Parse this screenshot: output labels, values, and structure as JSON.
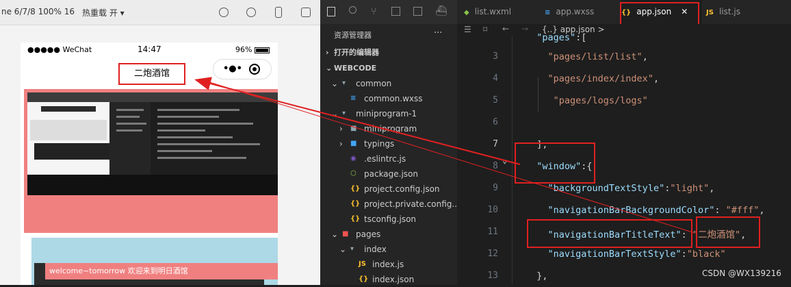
{
  "simulator": {
    "toolbar_device": "ne 6/7/8 100% 16",
    "toolbar_hotreload": "热重载 开",
    "status_carrier": "●●●●● WeChat",
    "status_time": "14:47",
    "status_battery": "96%",
    "nav_title": "二炮酒馆",
    "welcome_text": "welcome~tomorrow 欢迎来到明日酒馆"
  },
  "explorer": {
    "title": "资源管理器",
    "more": "···",
    "open_editors": "打开的编辑器",
    "workspace": "WEBCODE",
    "tree": [
      {
        "label": "common",
        "indent": 1,
        "kind": "folder-open"
      },
      {
        "label": "common.wxss",
        "indent": 2,
        "kind": "css"
      },
      {
        "label": "miniprogram-1",
        "indent": 1,
        "kind": "folder-open"
      },
      {
        "label": "miniprogram",
        "indent": 2,
        "kind": "folder"
      },
      {
        "label": "typings",
        "indent": 2,
        "kind": "folder-blue"
      },
      {
        "label": ".eslintrc.js",
        "indent": 2,
        "kind": "eslint"
      },
      {
        "label": "package.json",
        "indent": 2,
        "kind": "node"
      },
      {
        "label": "project.config.json",
        "indent": 2,
        "kind": "json"
      },
      {
        "label": "project.private.config....",
        "indent": 2,
        "kind": "json"
      },
      {
        "label": "tsconfig.json",
        "indent": 2,
        "kind": "json"
      },
      {
        "label": "pages",
        "indent": 1,
        "kind": "folder-red"
      },
      {
        "label": "index",
        "indent": 2,
        "kind": "folder-open"
      },
      {
        "label": "index.js",
        "indent": 3,
        "kind": "js"
      },
      {
        "label": "index.json",
        "indent": 3,
        "kind": "json"
      }
    ]
  },
  "tabs": [
    {
      "label": "list.wxml",
      "kind": "wxml"
    },
    {
      "label": "app.wxss",
      "kind": "css"
    },
    {
      "label": "app.json",
      "kind": "json",
      "active": true
    },
    {
      "label": "list.js",
      "kind": "js"
    }
  ],
  "breadcrumb": "{..} app.json >",
  "editor": {
    "lines": [
      {
        "num": "",
        "text": "  \"pages\":["
      },
      {
        "num": "3",
        "text": "    \"pages/list/list\","
      },
      {
        "num": "4",
        "text": "    \"pages/index/index\","
      },
      {
        "num": "5",
        "text": "     \"pages/logs/logs\""
      },
      {
        "num": "6",
        "text": ""
      },
      {
        "num": "7",
        "text": "  ],"
      },
      {
        "num": "8",
        "text": "  \"window\":{"
      },
      {
        "num": "9",
        "text": "    \"backgroundTextStyle\":\"light\","
      },
      {
        "num": "10",
        "text": "    \"navigationBarBackgroundColor\": \"#fff\","
      },
      {
        "num": "11",
        "text": "    \"navigationBarTitleText\": \"二炮酒馆\","
      },
      {
        "num": "12",
        "text": "    \"navigationBarTextStyle\":\"black\""
      },
      {
        "num": "13",
        "text": "  },"
      }
    ]
  },
  "watermark": "CSDN @WX139216",
  "colors": {
    "annotation_red": "#e02020",
    "string": "#ce9178",
    "key": "#9cdcfe",
    "pink": "#f08080",
    "lightblue": "#add8e6"
  }
}
